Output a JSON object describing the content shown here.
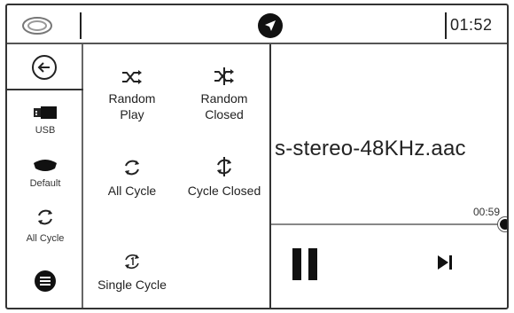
{
  "topbar": {
    "clock": "01:52"
  },
  "sidebar": {
    "items": [
      {
        "label": "USB",
        "icon": "usb-icon"
      },
      {
        "label": "Default",
        "icon": "eq-default-icon"
      },
      {
        "label": "All Cycle",
        "icon": "all-cycle-icon"
      }
    ]
  },
  "play_mode_panel": {
    "options": [
      {
        "label": "Random\nPlay",
        "icon": "shuffle-icon"
      },
      {
        "label": "Random\nClosed",
        "icon": "shuffle-off-icon"
      },
      {
        "label": "All Cycle",
        "icon": "repeat-all-icon"
      },
      {
        "label": "Cycle Closed",
        "icon": "repeat-off-icon"
      },
      {
        "label": "Single Cycle",
        "icon": "repeat-one-icon"
      }
    ]
  },
  "player": {
    "filename": "s-stereo-48KHz.aac",
    "elapsed": "00:59",
    "progress": 1.0
  }
}
